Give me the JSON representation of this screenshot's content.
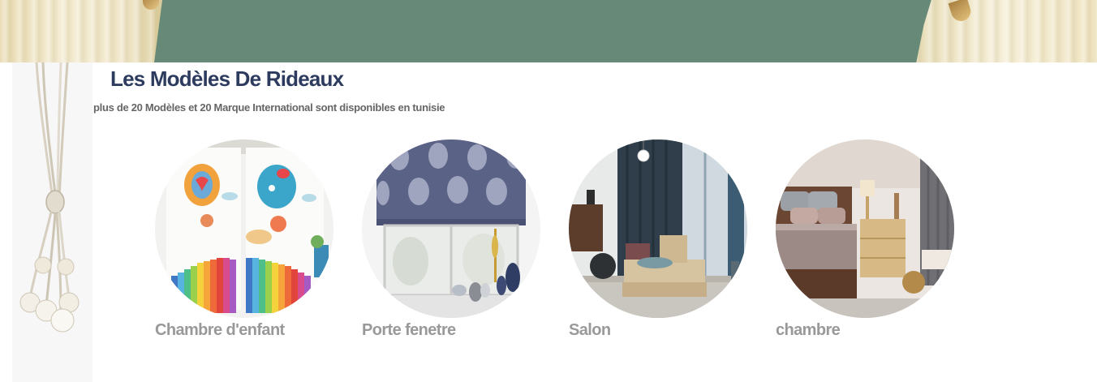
{
  "section": {
    "title": "Les Modèles De Rideaux",
    "subtitle": "plus de 20 Modèles et 20 Marque International sont disponibles en tunisie"
  },
  "categories": [
    {
      "label": "Chambre d'enfant",
      "image": "kids-room-curtains-image"
    },
    {
      "label": "Porte fenetre",
      "image": "roman-blind-window-image"
    },
    {
      "label": "Salon",
      "image": "living-room-curtains-image"
    },
    {
      "label": "chambre",
      "image": "bedroom-curtains-image"
    }
  ],
  "colors": {
    "banner": "#668a77",
    "title": "#2c3b5e",
    "subtitle": "#666666",
    "category_label": "#999999"
  }
}
